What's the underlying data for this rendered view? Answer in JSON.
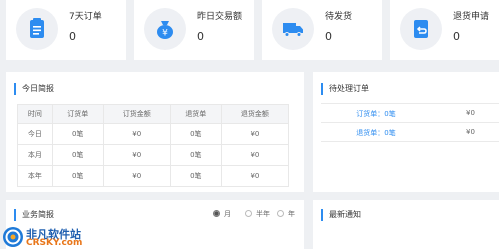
{
  "stats": [
    {
      "label": "7天订单",
      "value": "0",
      "icon": "clipboard-icon"
    },
    {
      "label": "昨日交易额",
      "value": "0",
      "icon": "money-bag-icon"
    },
    {
      "label": "待发货",
      "value": "0",
      "icon": "truck-icon"
    },
    {
      "label": "退货申请",
      "value": "0",
      "icon": "return-icon"
    }
  ],
  "today_report": {
    "title": "今日简报",
    "headers": [
      "时间",
      "订货单",
      "订货金额",
      "退货单",
      "退货金额"
    ],
    "rows": [
      [
        "今日",
        "0笔",
        "¥0",
        "0笔",
        "¥0"
      ],
      [
        "本月",
        "0笔",
        "¥0",
        "0笔",
        "¥0"
      ],
      [
        "本年",
        "0笔",
        "¥0",
        "0笔",
        "¥0"
      ]
    ]
  },
  "pending": {
    "title": "待处理订单",
    "items": [
      {
        "label": "订货单：0笔",
        "value": "¥0"
      },
      {
        "label": "退货单：0笔",
        "value": "¥0"
      }
    ]
  },
  "business": {
    "title": "业务简报",
    "options": [
      "月",
      "半年",
      "年"
    ],
    "selected": "月"
  },
  "news": {
    "title": "最新通知"
  },
  "watermark": {
    "cn": "非凡软件站",
    "en": "CRSKY.com"
  },
  "colors": {
    "accent": "#2d8cf0",
    "icon": "#2d8cf0",
    "background": "#eef0f3"
  }
}
